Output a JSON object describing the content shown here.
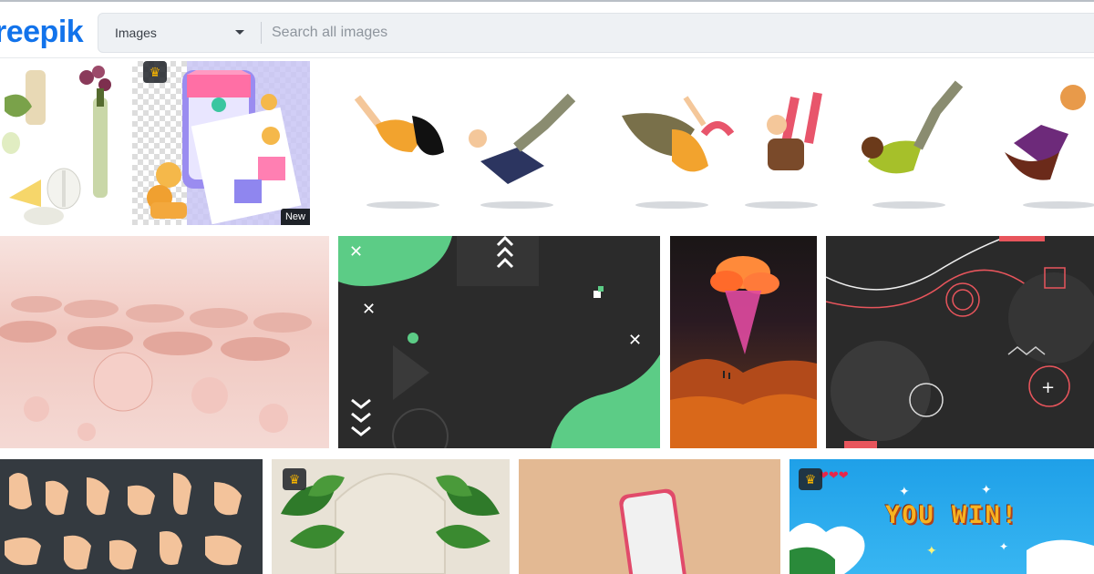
{
  "header": {
    "logo_text": "reepik",
    "search": {
      "type_selected": "Images",
      "placeholder": "Search all images"
    }
  },
  "badges": {
    "new_label": "New",
    "you_win_text": "YOU WIN!"
  },
  "tiles": [
    {
      "name": "wine-cheese-illustration",
      "premium": false
    },
    {
      "name": "shopping-receipt-3d",
      "premium": true,
      "is_new": true
    },
    {
      "name": "falling-people-illustration",
      "premium": false
    },
    {
      "name": "pink-bubbles-3d",
      "premium": false
    },
    {
      "name": "dark-geometric-green-background",
      "premium": false
    },
    {
      "name": "surreal-cloud-landscape",
      "premium": false
    },
    {
      "name": "dark-memphis-background",
      "premium": false
    },
    {
      "name": "hand-gestures-set",
      "premium": false
    },
    {
      "name": "monstera-plants-arch",
      "premium": true
    },
    {
      "name": "phone-mockup-beige",
      "premium": false
    },
    {
      "name": "pixel-you-win-screen",
      "premium": true
    }
  ],
  "colors": {
    "brand": "#1273eb",
    "crown": "#f5b300",
    "search_bg": "#eef1f4"
  }
}
